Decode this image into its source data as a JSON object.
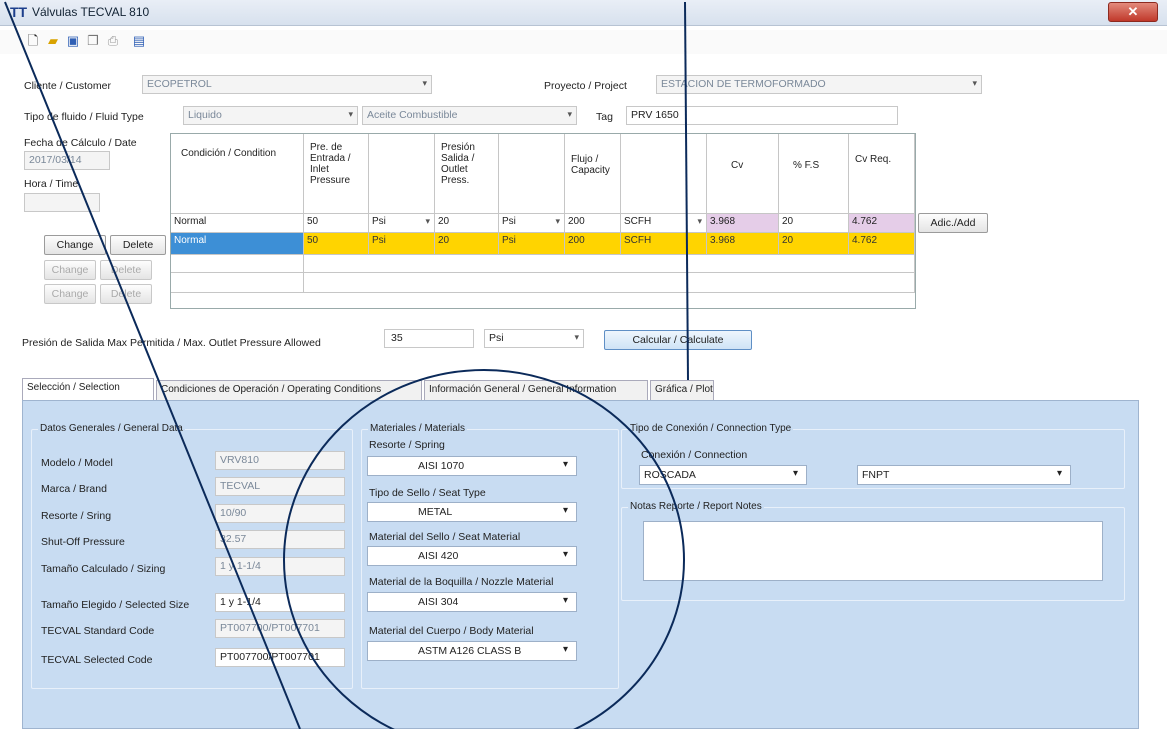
{
  "window": {
    "title": "Válvulas TECVAL 810",
    "logo": "TT",
    "close": "✕"
  },
  "toolbar": {
    "icons": [
      "new-icon",
      "open-icon",
      "save-icon",
      "copy-icon",
      "print-icon",
      "export-icon"
    ]
  },
  "header": {
    "customer_label": "Cliente / Customer",
    "customer_value": "ECOPETROL",
    "project_label": "Proyecto / Project",
    "project_value": "ESTACION DE TERMOFORMADO",
    "fluid_label": "Tipo de fluido / Fluid Type",
    "fluid_value": "Liquido",
    "fluid_sub_value": "Aceite Combustible",
    "tag_label": "Tag",
    "tag_value": "PRV 1650",
    "date_label": "Fecha de Cálculo / Date",
    "date_value": "2017/03/14",
    "time_label": "Hora / Time",
    "time_value": ""
  },
  "grid": {
    "headers": [
      "Condición / Condition",
      "Pre. de Entrada / Inlet Pressure",
      "",
      "Presión Salida / Outlet Press.",
      "",
      "Flujo / Capacity",
      "",
      "Cv",
      "% F.S",
      "Cv Req.",
      ""
    ],
    "input_row": [
      "Normal",
      "50",
      "Psi",
      "20",
      "Psi",
      "200",
      "SCFH",
      "3.968",
      "20",
      "4.762"
    ],
    "data_row": [
      "Normal",
      "50",
      "Psi",
      "20",
      "Psi",
      "200",
      "SCFH",
      "3.968",
      "20",
      "4.762"
    ],
    "add_button": "Adic./Add"
  },
  "row_buttons": {
    "change": "Change",
    "delete": "Delete"
  },
  "outlet": {
    "label": "Presión de Salida Max Permitida / Max. Outlet Pressure Allowed",
    "value": "35",
    "unit": "Psi",
    "calc_button": "Calcular / Calculate"
  },
  "tabs": [
    "Selección / Selection",
    "Condiciones de Operación / Operating Conditions",
    "Información General / General Information",
    "Gráfica / Plot"
  ],
  "general": {
    "title": "Datos Generales / General Data",
    "rows": [
      {
        "label": "Modelo / Model",
        "value": "VRV810"
      },
      {
        "label": "Marca / Brand",
        "value": "TECVAL"
      },
      {
        "label": "Resorte / Sring",
        "value": "10/90"
      },
      {
        "label": "Shut-Off Pressure",
        "value": "32.57"
      },
      {
        "label": "Tamaño Calculado / Sizing",
        "value": "1 y 1-1/4"
      },
      {
        "label": "Tamaño Elegido / Selected Size",
        "value": "1 y 1-1/4"
      },
      {
        "label": "TECVAL Standard Code",
        "value": "PT007700/PT007701"
      },
      {
        "label": "TECVAL Selected Code",
        "value": "PT007700/PT007701"
      }
    ]
  },
  "materials": {
    "title": "Materiales / Materials",
    "items": [
      {
        "label": "Resorte / Spring",
        "value": "AISI 1070"
      },
      {
        "label": "Tipo de Sello / Seat Type",
        "value": "METAL"
      },
      {
        "label": "Material del Sello / Seat Material",
        "value": "AISI 420"
      },
      {
        "label": "Material de la Boquilla / Nozzle Material",
        "value": "AISI 304"
      },
      {
        "label": "Material del Cuerpo / Body Material",
        "value": "ASTM A126 CLASS B"
      }
    ]
  },
  "connection": {
    "title": "Tipo de Conexión / Connection Type",
    "sub_label": "Conexión / Connection",
    "value1": "ROSCADA",
    "value2": "FNPT",
    "notes_title": "Notas Reporte / Report Notes"
  },
  "colors": {
    "accent": "#3d8fd6",
    "highlight": "#ffd400",
    "panel": "#c8dcf2",
    "annotation": "#0b2a5a"
  }
}
